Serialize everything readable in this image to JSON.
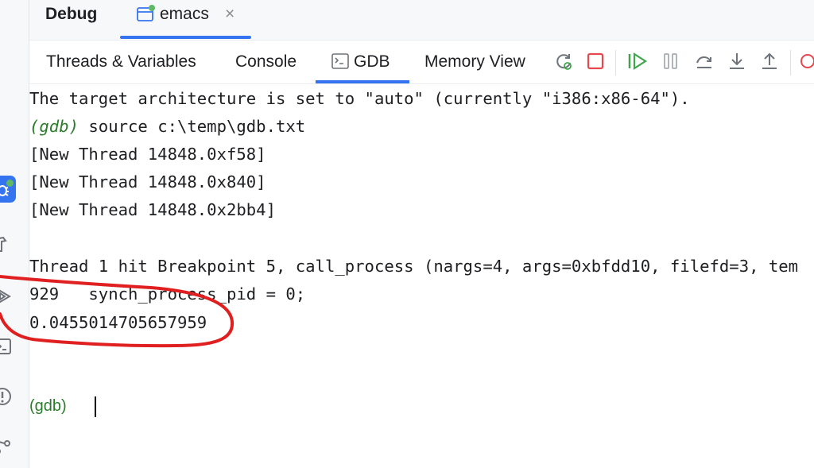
{
  "header": {
    "tool_title": "Debug",
    "session_tab": {
      "label": "emacs",
      "close_glyph": "×",
      "icon": "window-icon",
      "status": "running"
    }
  },
  "tabs": [
    {
      "label": "Threads & Variables"
    },
    {
      "label": "Console"
    },
    {
      "label": "GDB",
      "icon": "terminal-icon",
      "active": true
    },
    {
      "label": "Memory View"
    }
  ],
  "toolbar_actions": [
    "rerun-debug-icon",
    "stop-icon",
    "resume-icon",
    "pause-icon",
    "step-over-icon",
    "step-into-icon",
    "step-out-icon",
    "breakpoints-icon"
  ],
  "sidebar_icons": [
    "debug-icon",
    "build-icon",
    "run-icon",
    "terminal-icon",
    "problems-icon",
    "git-icon"
  ],
  "console": {
    "lines": [
      "The target architecture is set to \"auto\" (currently \"i386:x86-64\").",
      "(gdb)",
      " source c:\\temp\\gdb.txt",
      "[New Thread 14848.0xf58]",
      "[New Thread 14848.0x840]",
      "[New Thread 14848.0x2bb4]",
      "Thread 1 hit Breakpoint 5, call_process (nargs=4, args=0xbfdd10, filefd=3, tem",
      "929   synch_process_pid = 0;",
      "0.0455014705657959",
      "(gdb)"
    ]
  },
  "colors": {
    "accent": "#3574f0",
    "prompt": "#2a7d2a",
    "annotation": "#e02020",
    "stop": "#e5484d",
    "resume": "#3ea54b"
  }
}
